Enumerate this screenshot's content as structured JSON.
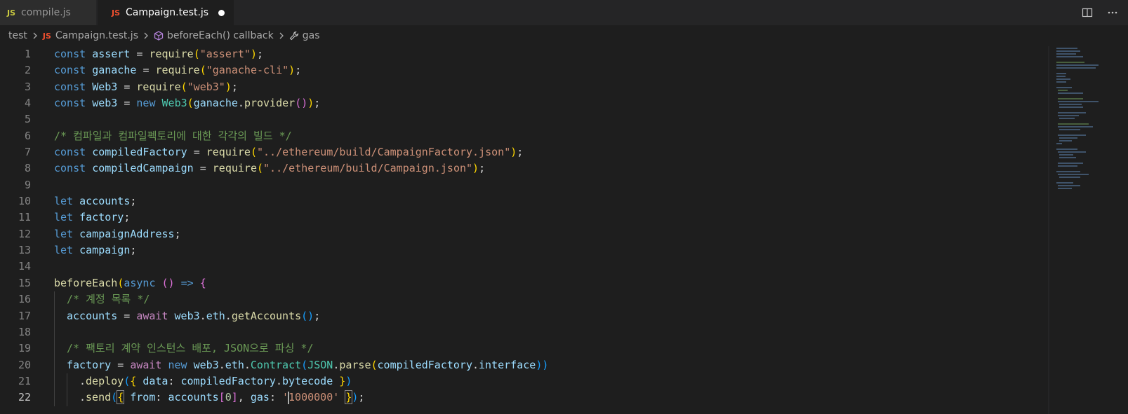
{
  "tabs": [
    {
      "badge": "JS",
      "label": "compile.js"
    },
    {
      "badge": "JS",
      "label": "Campaign.test.js"
    }
  ],
  "breadcrumb": {
    "folder": "test",
    "file_badge": "JS",
    "file": "Campaign.test.js",
    "symbol": "beforeEach() callback",
    "leaf": "gas"
  },
  "icons": [
    "split-editor-icon",
    "more-actions-icon",
    "chevron-right-icon",
    "cube-method-icon",
    "wrench-property-icon"
  ],
  "editor": {
    "current_line": 22,
    "lines": [
      {
        "n": "1"
      },
      {
        "n": "2"
      },
      {
        "n": "3"
      },
      {
        "n": "4"
      },
      {
        "n": "5"
      },
      {
        "n": "6"
      },
      {
        "n": "7"
      },
      {
        "n": "8"
      },
      {
        "n": "9"
      },
      {
        "n": "10"
      },
      {
        "n": "11"
      },
      {
        "n": "12"
      },
      {
        "n": "13"
      },
      {
        "n": "14"
      },
      {
        "n": "15"
      },
      {
        "n": "16"
      },
      {
        "n": "17"
      },
      {
        "n": "18"
      },
      {
        "n": "19"
      },
      {
        "n": "20"
      },
      {
        "n": "21"
      },
      {
        "n": "22"
      }
    ],
    "tokens": {
      "l1": [
        "const",
        "assert",
        "=",
        "require",
        "(",
        "\"assert\"",
        ")",
        ";"
      ],
      "l2": [
        "const",
        "ganache",
        "=",
        "require",
        "(",
        "\"ganache-cli\"",
        ")",
        ";"
      ],
      "l3": [
        "const",
        "Web3",
        "=",
        "require",
        "(",
        "\"web3\"",
        ")",
        ";"
      ],
      "l4": [
        "const",
        "web3",
        "=",
        "new",
        "Web3",
        "(",
        "ganache",
        ".",
        "provider",
        "()",
        ")",
        ";"
      ],
      "l6": [
        "/* 컴파일과 컴파일펙토리에 대한 각각의 빌드 */"
      ],
      "l7": [
        "const",
        "compiledFactory",
        "=",
        "require",
        "(",
        "\"../ethereum/build/CampaignFactory.json\"",
        ")",
        ";"
      ],
      "l8": [
        "const",
        "compiledCampaign",
        "=",
        "require",
        "(",
        "\"../ethereum/build/Campaign.json\"",
        ")",
        ";"
      ],
      "l10": [
        "let",
        "accounts",
        ";"
      ],
      "l11": [
        "let",
        "factory",
        ";"
      ],
      "l12": [
        "let",
        "campaignAddress",
        ";"
      ],
      "l13": [
        "let",
        "campaign",
        ";"
      ],
      "l15": [
        "beforeEach",
        "(",
        "async",
        "()",
        "=>",
        "{"
      ],
      "l16": [
        "/* 계정 목록 */"
      ],
      "l17": [
        "accounts",
        "=",
        "await",
        "web3",
        ".",
        "eth",
        ".",
        "getAccounts",
        "()",
        ";"
      ],
      "l19": [
        "/* 팩토리 계약 인스턴스 배포, JSON으로 파싱 */"
      ],
      "l20": [
        "factory",
        "=",
        "await",
        "new",
        "web3",
        ".",
        "eth",
        ".",
        "Contract",
        "(",
        "JSON",
        ".",
        "parse",
        "(",
        "compiledFactory",
        ".",
        "interface",
        "))"
      ],
      "l21": [
        ".",
        "deploy",
        "(",
        "{",
        "data",
        ":",
        "compiledFactory",
        ".",
        "bytecode",
        "}",
        ")"
      ],
      "l22": [
        ".",
        "send",
        "(",
        "{",
        "from",
        ":",
        "accounts",
        "[",
        "0",
        "]",
        ",",
        "gas",
        ":",
        "'",
        "1000000'",
        "}",
        ")",
        ";"
      ]
    }
  },
  "colors": {
    "background": "#1e1e1e",
    "keyword": "#569cd6",
    "variable": "#9cdcfe",
    "function": "#dcdcaa",
    "string": "#ce9178",
    "comment": "#6a9955",
    "control": "#c586c0"
  }
}
